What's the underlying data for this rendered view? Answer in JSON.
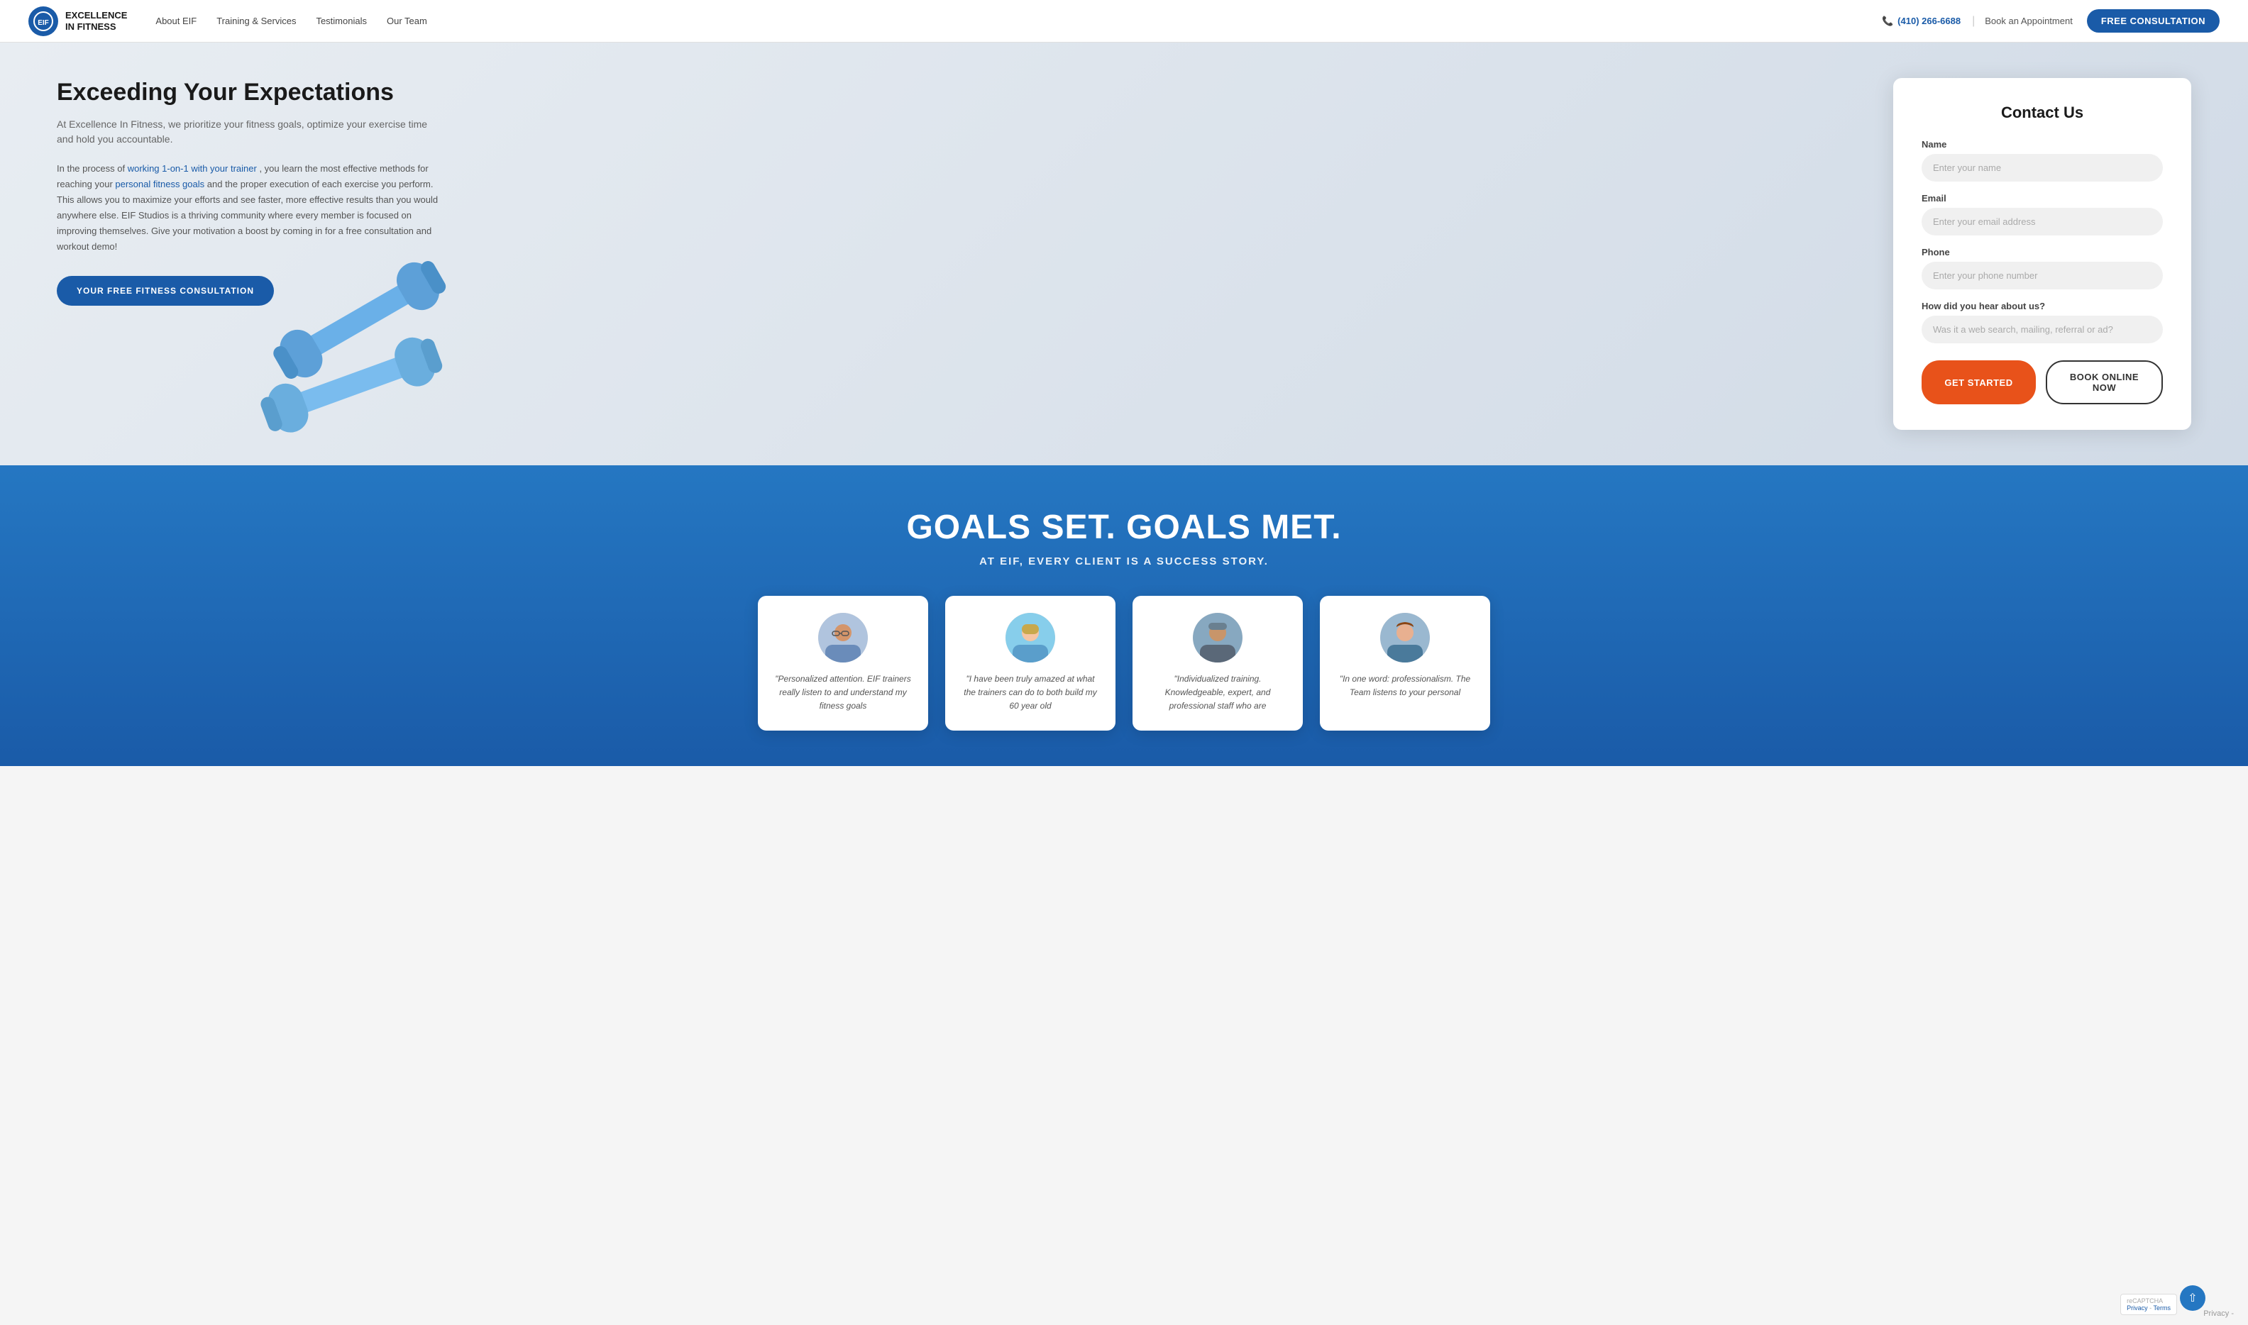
{
  "nav": {
    "logo_initials": "EIF",
    "logo_name_line1": "EXCELLENCE",
    "logo_name_line2": "IN FITNESS",
    "links": [
      {
        "label": "About EIF",
        "href": "#"
      },
      {
        "label": "Training & Services",
        "href": "#"
      },
      {
        "label": "Testimonials",
        "href": "#"
      },
      {
        "label": "Our Team",
        "href": "#"
      }
    ],
    "phone_icon": "📞",
    "phone": "(410) 266-6688",
    "book_label": "Book an Appointment",
    "cta_label": "FREE CONSULTATION"
  },
  "hero": {
    "title": "Exceeding Your Expectations",
    "subtitle": "At Excellence In Fitness, we prioritize your fitness goals, optimize your exercise time and hold you accountable.",
    "body_part1": "In the process of ",
    "link1_text": "working 1-on-1 with your trainer",
    "body_part2": ", you learn the most effective methods for reaching your ",
    "link2_text": "personal fitness goals",
    "body_part3": " and the proper execution of each exercise you perform. This allows you to maximize your efforts and see faster, more effective results than you would anywhere else. EIF Studios is a thriving community where every member is focused on improving themselves. Give your motivation a boost by coming in for a free consultation and workout demo!",
    "cta_label": "YOUR FREE FITNESS CONSULTATION"
  },
  "contact_form": {
    "title": "Contact Us",
    "name_label": "Name",
    "name_placeholder": "Enter your name",
    "email_label": "Email",
    "email_placeholder": "Enter your email address",
    "phone_label": "Phone",
    "phone_placeholder": "Enter your phone number",
    "hear_label": "How did you hear about us?",
    "hear_placeholder": "Was it a web search, mailing, referral or ad?",
    "btn_get_started": "GET STARTED",
    "btn_book_online": "BOOK ONLINE NOW"
  },
  "goals": {
    "title": "GOALS SET. GOALS MET.",
    "subtitle": "AT EIF, EVERY CLIENT IS A SUCCESS STORY."
  },
  "testimonials": [
    {
      "avatar_emoji": "👨",
      "text": "\"Personalized attention. EIF trainers really listen to and understand my fitness goals"
    },
    {
      "avatar_emoji": "👩",
      "text": "\"I have been truly amazed at what the trainers can do to both build my 60 year old"
    },
    {
      "avatar_emoji": "🧔",
      "text": "\"Individualized training. Knowledgeable, expert, and professional staff who are"
    },
    {
      "avatar_emoji": "👩‍🦱",
      "text": "\"In one word: professionalism. The Team listens to your personal"
    }
  ],
  "footer": {
    "privacy_label": "Privacy -"
  },
  "recaptcha": {
    "text": "reCAPTCHA\nPrivacy - Terms"
  }
}
